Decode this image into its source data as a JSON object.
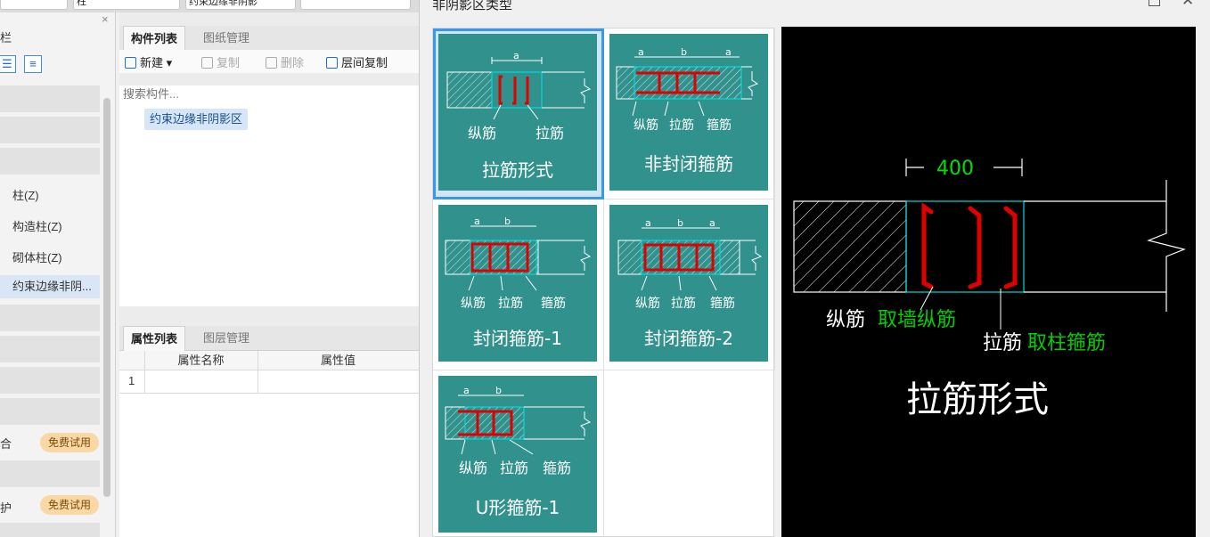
{
  "topbar": {
    "box1": "",
    "box2": "柱",
    "box3": "约束边缘非阴影",
    "box4": ""
  },
  "left_panel": {
    "close_glyph": "×",
    "title_fragment": "栏",
    "items": [
      {
        "label": "柱(Z)"
      },
      {
        "label": "构造柱(Z)"
      },
      {
        "label": "砌体柱(Z)"
      },
      {
        "label": "约束边缘非阴..."
      }
    ],
    "fragment_a": "",
    "fragment_b": "",
    "badges": [
      {
        "prefix": "合",
        "label": "免费试用"
      },
      {
        "prefix": "护",
        "label": "免费试用"
      }
    ]
  },
  "component_panel": {
    "tabs": [
      "构件列表",
      "图纸管理"
    ],
    "toolbar": {
      "new": "新建",
      "copy": "复制",
      "delete": "删除",
      "floor_copy": "层间复制"
    },
    "search_placeholder": "搜索构件...",
    "items": [
      "约束边缘非阴影区"
    ]
  },
  "property_panel": {
    "tabs": [
      "属性列表",
      "图层管理"
    ],
    "columns": [
      "属性名称",
      "属性值"
    ],
    "rows": [
      {
        "num": "1",
        "name": "",
        "value": ""
      }
    ]
  },
  "dialog": {
    "title": "非阴影区类型",
    "options": [
      {
        "label": "拉筋形式",
        "selected": true,
        "sub1": "纵筋",
        "sub2": "拉筋",
        "sub3": "",
        "dims": "a"
      },
      {
        "label": "非封闭箍筋",
        "selected": false,
        "sub1": "纵筋",
        "sub2": "拉筋",
        "sub3": "箍筋",
        "dims": "a b a"
      },
      {
        "label": "封闭箍筋-1",
        "selected": false,
        "sub1": "纵筋",
        "sub2": "拉筋",
        "sub3": "箍筋",
        "dims": "a b"
      },
      {
        "label": "封闭箍筋-2",
        "selected": false,
        "sub1": "纵筋",
        "sub2": "拉筋",
        "sub3": "箍筋",
        "dims": "a b a"
      },
      {
        "label": "U形箍筋-1",
        "selected": false,
        "sub1": "纵筋",
        "sub2": "拉筋",
        "sub3": "箍筋",
        "dims": "a b"
      }
    ],
    "preview": {
      "dimension": "400",
      "label1_white": "纵筋",
      "label1_green": "取墙纵筋",
      "label2_white": "拉筋",
      "label2_green": "取柱箍筋",
      "title": "拉筋形式"
    }
  },
  "colors": {
    "card_bg": "#31918d",
    "selected_border": "#3a97ea",
    "rebar_red": "#e00000",
    "preview_bg": "#000000",
    "preview_green": "#00d000"
  }
}
